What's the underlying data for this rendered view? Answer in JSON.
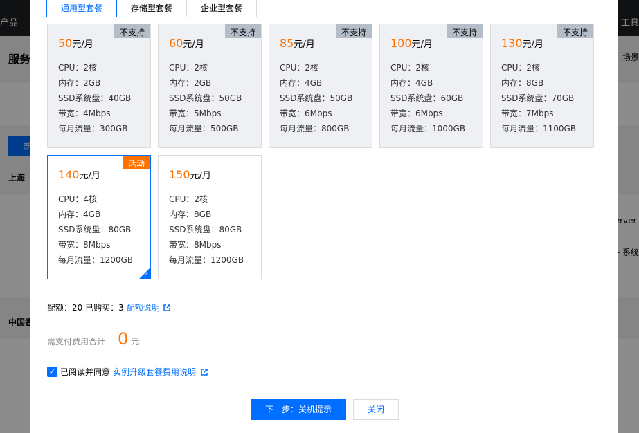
{
  "background": {
    "topbar_left": "产品",
    "topbar_right": "工具",
    "page_title": "服务",
    "right_note": "场景",
    "new_button": "新",
    "region_1": "上海",
    "region_2": "中国香",
    "server_text_1": "erver-",
    "server_text_2": "- 系统"
  },
  "tabs": [
    {
      "label": "通用型套餐"
    },
    {
      "label": "存储型套餐"
    },
    {
      "label": "企业型套餐"
    }
  ],
  "unit_label": "元/月",
  "spec_labels": {
    "cpu": "CPU：",
    "memory": "内存：",
    "disk": "SSD系统盘：",
    "bandwidth": "带宽：",
    "traffic": "每月流量："
  },
  "plans": [
    {
      "price": "50",
      "badge": "不支持",
      "cpu": "2核",
      "memory": "2GB",
      "disk": "40GB",
      "bandwidth": "4Mbps",
      "traffic": "300GB"
    },
    {
      "price": "60",
      "badge": "不支持",
      "cpu": "2核",
      "memory": "2GB",
      "disk": "50GB",
      "bandwidth": "5Mbps",
      "traffic": "500GB"
    },
    {
      "price": "85",
      "badge": "不支持",
      "cpu": "2核",
      "memory": "4GB",
      "disk": "50GB",
      "bandwidth": "6Mbps",
      "traffic": "800GB"
    },
    {
      "price": "100",
      "badge": "不支持",
      "cpu": "2核",
      "memory": "4GB",
      "disk": "60GB",
      "bandwidth": "6Mbps",
      "traffic": "1000GB"
    },
    {
      "price": "130",
      "badge": "不支持",
      "cpu": "2核",
      "memory": "8GB",
      "disk": "70GB",
      "bandwidth": "7Mbps",
      "traffic": "1100GB"
    },
    {
      "price": "140",
      "badge": "活动",
      "cpu": "4核",
      "memory": "4GB",
      "disk": "80GB",
      "bandwidth": "8Mbps",
      "traffic": "1200GB"
    },
    {
      "price": "150",
      "badge": "",
      "cpu": "2核",
      "memory": "8GB",
      "disk": "80GB",
      "bandwidth": "8Mbps",
      "traffic": "1200GB"
    }
  ],
  "quota": {
    "text": "配额：20  已购买：3",
    "link": "配额说明"
  },
  "cost": {
    "label": "需支付费用合计",
    "value": "0",
    "unit": "元"
  },
  "agreement": {
    "text": "已阅读并同意",
    "link": "实例升级套餐费用说明"
  },
  "buttons": {
    "next": "下一步：关机提示",
    "close": "关闭"
  },
  "colors": {
    "accent": "#006eff",
    "price": "#ff7200"
  }
}
